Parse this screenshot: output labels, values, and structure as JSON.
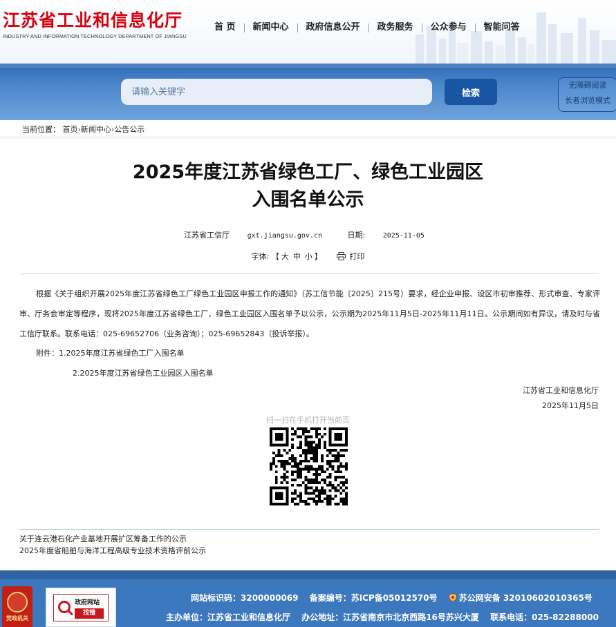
{
  "header": {
    "logo_cn": "江苏省工业和信息化厅",
    "logo_en": "INDUSTRY AND INFORMATION TECHNOLOGY DEPARTMENT OF JIANGSU",
    "nav": [
      "首 页",
      "新闻中心",
      "政府信息公开",
      "政务服务",
      "公众参与",
      "智能问答"
    ]
  },
  "search": {
    "placeholder": "请输入关键字",
    "button": "检索",
    "access": [
      "无障碍阅读",
      "长者浏览模式"
    ]
  },
  "breadcrumb": {
    "prefix": "当前位置：",
    "items": [
      "首页",
      "新闻中心",
      "公告公示"
    ],
    "separator": "›"
  },
  "article": {
    "title_line1": "2025年度江苏省绿色工厂、绿色工业园区",
    "title_line2": "入围名单公示",
    "source": "江苏省工信厅",
    "site": "gxt.jiangsu.gov.cn",
    "date_label": "日期:",
    "date": "2025-11-05",
    "font_label": "字体:",
    "bracket_open": "【",
    "size_large": "大",
    "size_medium": "中",
    "size_small": "小",
    "bracket_close": "】",
    "print": "打印",
    "body": "根据《关于组织开展2025年度江苏省绿色工厂绿色工业园区申报工作的通知》（苏工信节能〔2025〕215号）要求，经企业申报、设区市初审推荐、形式审查、专家评审、厅务会审定等程序，现将2025年度江苏省绿色工厂、绿色工业园区入围名单予以公示，公示期为2025年11月5日-2025年11月11日。公示期间如有异议，请及时与省工信厅联系。联系电话：025-69652706（业务咨询）；025-69652843（投诉举报）。",
    "attachment1": "附件：1.2025年度江苏省绿色工厂入围名单",
    "attachment2": "2.2025年度江苏省绿色工业园区入围名单",
    "sign_org": "江苏省工业和信息化厅",
    "sign_date": "2025年11月5日",
    "qr_caption": "扫一扫在手机打开当前页"
  },
  "related": [
    "关于连云港石化产业基地开展扩区筹备工作的公示",
    "2025年度省船舶与海洋工程高级专业技术资格评前公示"
  ],
  "footer": {
    "party_badge": "党政机关",
    "gov_badge_title": "政府网站",
    "gov_badge_btn": "找错",
    "site_code": "网站标识码：3200000069",
    "icp": "备案编号：苏ICP备05012570号",
    "police": "苏公网安备 32010602010365号",
    "host": "主办单位：江苏省工业和信息化厅",
    "address": "办公地址：江苏省南京市北京西路16号苏兴大厦",
    "phone": "联系电话：025-82288000"
  },
  "colors": {
    "brand_red": "#d7000f",
    "banner_blue": "#4d88cc",
    "button_blue": "#1856a3",
    "footer_blue": "#3c78bd"
  }
}
